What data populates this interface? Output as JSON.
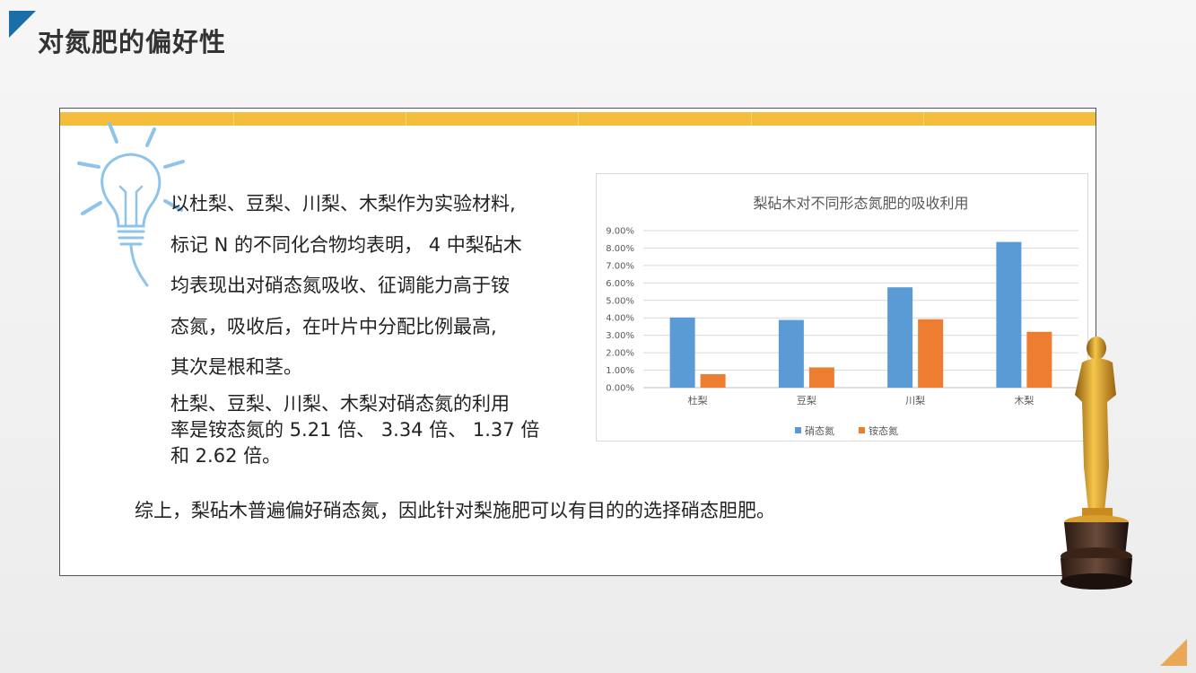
{
  "page": {
    "title": "对氮肥的偏好性"
  },
  "paragraphs": {
    "p1_lines": [
      "以杜梨、豆梨、川梨、木梨作为实验材料,",
      "标记 N 的不同化合物均表明， 4 中梨砧木",
      "均表现出对硝态氮吸收、征调能力高于铵",
      "态氮，吸收后，在叶片中分配比例最高,",
      "其次是根和茎。"
    ],
    "p2_lines": [
      "杜梨、豆梨、川梨、木梨对硝态氮的利用",
      "率是铵态氮的 5.21 倍、 3.34 倍、 1.37 倍",
      "和 2.62 倍。"
    ],
    "summary": "综上，梨砧木普遍偏好硝态氮，因此针对梨施肥可以有目的的选择硝态胆肥。"
  },
  "colors": {
    "nitrate": "#5b9bd5",
    "ammonium": "#ed7d31",
    "accent_bar": "#f5bd3c",
    "corner_blue": "#1a6fa8",
    "corner_orange": "#e8a857"
  },
  "chart_data": {
    "type": "bar",
    "title": "梨砧木对不同形态氮肥的吸收利用",
    "categories": [
      "杜梨",
      "豆梨",
      "川梨",
      "木梨"
    ],
    "series": [
      {
        "name": "硝态氮",
        "values": [
          0.0402,
          0.0388,
          0.0575,
          0.0835
        ],
        "color": "#5b9bd5"
      },
      {
        "name": "铵态氮",
        "values": [
          0.0077,
          0.0116,
          0.0392,
          0.032
        ],
        "color": "#ed7d31"
      }
    ],
    "ylim": [
      0,
      0.09
    ],
    "yticks": [
      "0.00%",
      "1.00%",
      "2.00%",
      "3.00%",
      "4.00%",
      "5.00%",
      "6.00%",
      "7.00%",
      "8.00%",
      "9.00%"
    ],
    "legend_position": "bottom",
    "grid": true
  }
}
